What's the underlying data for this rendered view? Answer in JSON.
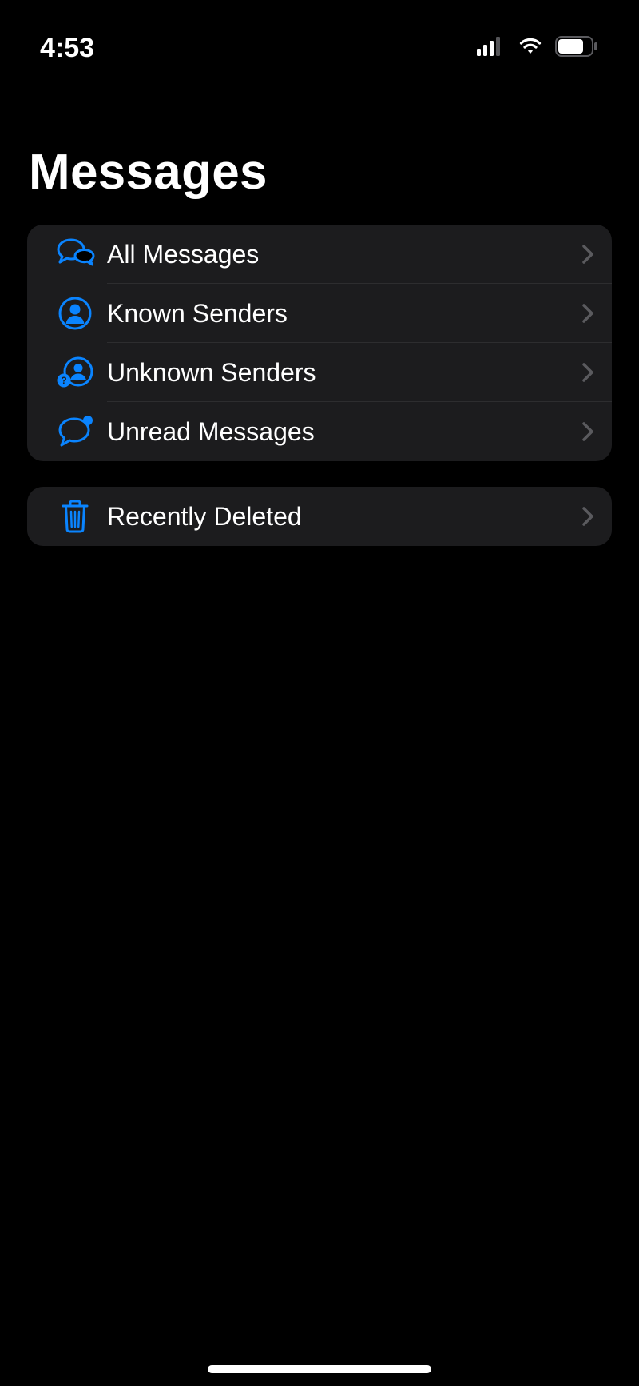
{
  "status": {
    "time": "4:53"
  },
  "header": {
    "title": "Messages"
  },
  "groups": [
    {
      "id": "filters",
      "items": [
        {
          "id": "all-messages",
          "icon": "chat-bubbles-icon",
          "label": "All Messages"
        },
        {
          "id": "known-senders",
          "icon": "person-circle-icon",
          "label": "Known Senders"
        },
        {
          "id": "unknown-senders",
          "icon": "person-question-icon",
          "label": "Unknown Senders"
        },
        {
          "id": "unread-messages",
          "icon": "chat-bubble-dot-icon",
          "label": "Unread Messages"
        }
      ]
    },
    {
      "id": "deleted",
      "items": [
        {
          "id": "recently-deleted",
          "icon": "trash-icon",
          "label": "Recently Deleted"
        }
      ]
    }
  ],
  "colors": {
    "accent": "#0a84ff",
    "background": "#000000",
    "cell": "#1c1c1e",
    "chevron": "#5a5a5e"
  }
}
